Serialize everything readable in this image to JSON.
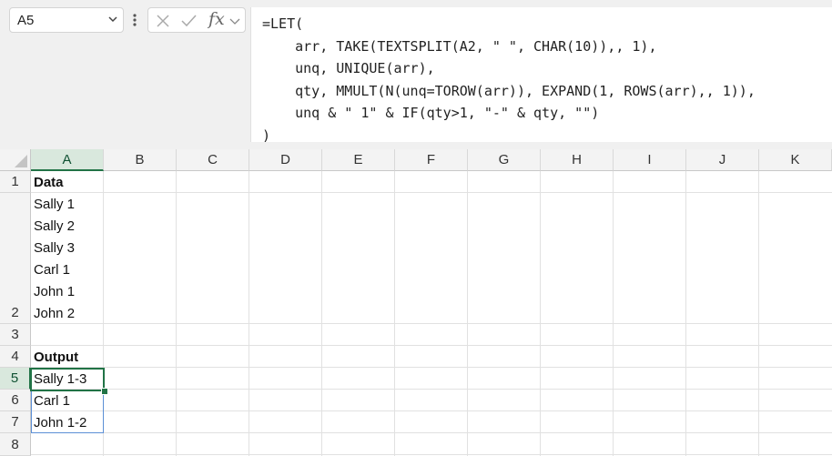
{
  "name_box": {
    "value": "A5"
  },
  "formula_bar": {
    "cancel_icon": "x-icon",
    "enter_icon": "check-icon",
    "fx_label": "fx",
    "lines": [
      "=LET(",
      "    arr, TAKE(TEXTSPLIT(A2, \" \", CHAR(10)),, 1),",
      "    unq, UNIQUE(arr),",
      "    qty, MMULT(N(unq=TOROW(arr)), EXPAND(1, ROWS(arr),, 1)),",
      "    unq & \" 1\" & IF(qty>1, \"-\" & qty, \"\")",
      ")"
    ]
  },
  "sheet": {
    "columns": [
      "A",
      "B",
      "C",
      "D",
      "E",
      "F",
      "G",
      "H",
      "I",
      "J",
      "K"
    ],
    "selected_column": "A",
    "rows": [
      "1",
      "2",
      "3",
      "4",
      "5",
      "6",
      "7",
      "8"
    ],
    "selected_row": "5",
    "cells": {
      "r1": "Data",
      "r2_lines": [
        "Sally 1",
        "Sally 2",
        "Sally 3",
        "Carl 1",
        "John 1",
        "John 2"
      ],
      "r4": "Output",
      "r5": "Sally 1-3",
      "r6": "Carl 1",
      "r7": "John 1-2"
    }
  },
  "colors": {
    "accent": "#217346",
    "spill_border": "#5b8fd6"
  }
}
